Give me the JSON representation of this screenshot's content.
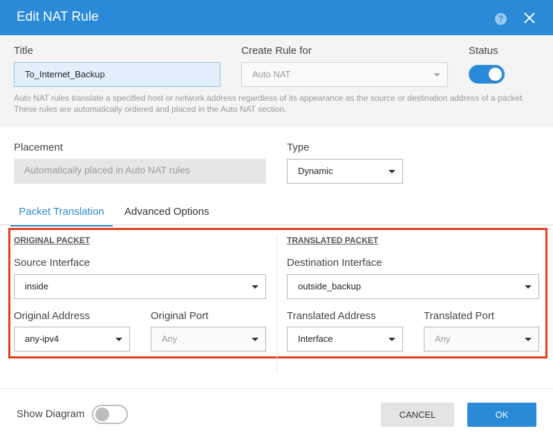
{
  "dialog": {
    "title": "Edit NAT Rule",
    "help_glyph": "?",
    "accent_color": "#2a8ad8",
    "highlight_color": "#e53b1b"
  },
  "top": {
    "title_label": "Title",
    "title_value": "To_Internet_Backup",
    "create_rule_label": "Create Rule for",
    "create_rule_value": "Auto NAT",
    "status_label": "Status",
    "status_on": true,
    "help_text": "Auto NAT rules translate a specified host or network address regardless of its appearance as the source or destination address of a packet. These rules are automatically ordered and placed in the Auto NAT section."
  },
  "placement": {
    "label": "Placement",
    "value": "Automatically placed in Auto NAT rules"
  },
  "type": {
    "label": "Type",
    "value": "Dynamic"
  },
  "tabs": [
    {
      "label": "Packet Translation",
      "active": true
    },
    {
      "label": "Advanced Options",
      "active": false
    }
  ],
  "original_packet": {
    "heading": "ORIGINAL PACKET",
    "source_interface_label": "Source Interface",
    "source_interface_value": "inside",
    "original_address_label": "Original Address",
    "original_address_value": "any-ipv4",
    "original_port_label": "Original Port",
    "original_port_value": "Any"
  },
  "translated_packet": {
    "heading": "TRANSLATED PACKET",
    "destination_interface_label": "Destination Interface",
    "destination_interface_value": "outside_backup",
    "translated_address_label": "Translated Address",
    "translated_address_value": "Interface",
    "translated_port_label": "Translated Port",
    "translated_port_value": "Any"
  },
  "footer": {
    "show_diagram_label": "Show Diagram",
    "show_diagram_on": false,
    "cancel_label": "CANCEL",
    "ok_label": "OK"
  }
}
